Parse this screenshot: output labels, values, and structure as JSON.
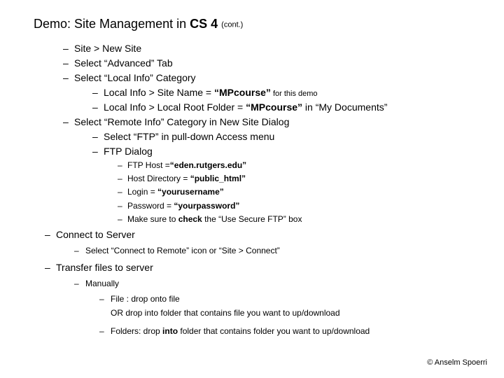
{
  "title": {
    "prefix": "Demo: Site Management in ",
    "bold": "CS 4",
    "cont": "(cont.)"
  },
  "top": {
    "i1": "Site > New Site",
    "i2": "Select “Advanced” Tab",
    "i3": "Select “Local Info” Category",
    "i3a_pre": "Local Info > Site Name = ",
    "i3a_bold": "“MPcourse”",
    "i3a_small": " for this demo",
    "i3b_pre": "Local Info > Local Root Folder = ",
    "i3b_bold": "“MPcourse”",
    "i3b_post": " in “My Documents”",
    "i4": "Select “Remote Info” Category in New Site Dialog",
    "i4a": "Select “FTP” in pull-down Access menu",
    "i4b": "FTP Dialog",
    "ftp1_pre": "FTP Host =",
    "ftp1_bold": "“eden.rutgers.edu”",
    "ftp2_pre": "Host Directory = ",
    "ftp2_bold": "“public_html”",
    "ftp3_pre": "Login = ",
    "ftp3_bold": "“yourusername”",
    "ftp4_pre": "Password = ",
    "ftp4_bold": "“yourpassword”",
    "ftp5_pre": "Make sure to ",
    "ftp5_bold": "check",
    "ftp5_post": " the “Use Secure FTP” box"
  },
  "connect": {
    "head": "Connect to Server",
    "sub": "Select “Connect to Remote” icon or “Site > Connect”"
  },
  "transfer": {
    "head": "Transfer files to server",
    "man": "Manually",
    "file_line1": "File : drop onto file",
    "file_line2": "OR drop into folder that contains file you want to up/download",
    "folders_pre": "Folders: drop ",
    "folders_bold": "into",
    "folders_post": " folder that contains folder you want to up/download"
  },
  "credit": "© Anselm Spoerri"
}
